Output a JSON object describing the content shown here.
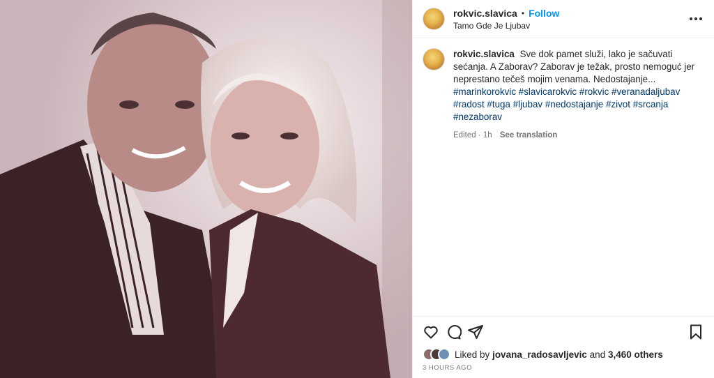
{
  "post": {
    "username": "rokvic.slavica",
    "follow_label": "Follow",
    "separator": "•",
    "location": "Tamo Gde Je Ljubav",
    "caption_text": "Sve dok pamet služi, lako je sačuvati sećanja. A Zaborav? Zaborav je težak, prosto nemoguć jer neprestano tečeš mojim venama. Nedostajanje...",
    "hashtags": [
      "#marinkorokvic",
      "#slavicarokvic",
      "#rokvic",
      "#veranadaljubav",
      "#radost",
      "#tuga",
      "#ljubav",
      "#nedostajanje",
      "#zivot",
      "#srcanja",
      "#nezaborav"
    ],
    "edited_time": "Edited · 1h",
    "see_translation": "See translation",
    "liked_by_prefix": "Liked by",
    "liked_by_user": "jovana_radosavljevic",
    "liked_by_and": "and",
    "liked_by_others": "3,460 others",
    "timestamp": "3 HOURS AGO"
  },
  "icons": {
    "more": "more-options-icon",
    "like": "heart-icon",
    "comment": "comment-icon",
    "share": "share-icon",
    "save": "bookmark-icon"
  },
  "colors": {
    "link_blue": "#0095f6",
    "hashtag": "#00376b",
    "muted": "#737373",
    "text": "#262626"
  }
}
